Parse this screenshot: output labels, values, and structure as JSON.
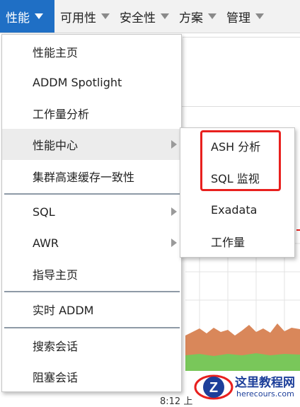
{
  "menubar": {
    "items": [
      {
        "label": "性能",
        "active": true
      },
      {
        "label": "可用性"
      },
      {
        "label": "安全性"
      },
      {
        "label": "方案"
      },
      {
        "label": "管理"
      }
    ]
  },
  "menu": {
    "items": [
      {
        "label": "性能主页"
      },
      {
        "label": "ADDM Spotlight"
      },
      {
        "label": "工作量分析"
      },
      {
        "label": "性能中心",
        "submenu": true,
        "hovered": true
      },
      {
        "label": "集群高速缓存一致性"
      },
      {
        "label": "SQL",
        "submenu": true
      },
      {
        "label": "AWR",
        "submenu": true
      },
      {
        "label": "指导主页"
      },
      {
        "label": "实时 ADDM"
      },
      {
        "label": "搜索会话"
      },
      {
        "label": "阻塞会话"
      }
    ]
  },
  "submenu": {
    "items": [
      {
        "label": "ASH 分析"
      },
      {
        "label": "SQL 监视"
      },
      {
        "label": "Exadata"
      },
      {
        "label": "工作量"
      }
    ]
  },
  "background": {
    "time_label": "8:12 上"
  },
  "watermark": {
    "title": "这里教程网",
    "url": "herecours.com"
  },
  "colors": {
    "active_menu": "#1f6fc5",
    "highlight_box": "#e8201e",
    "chart_orange": "#d9875a",
    "chart_green": "#79c75a"
  }
}
